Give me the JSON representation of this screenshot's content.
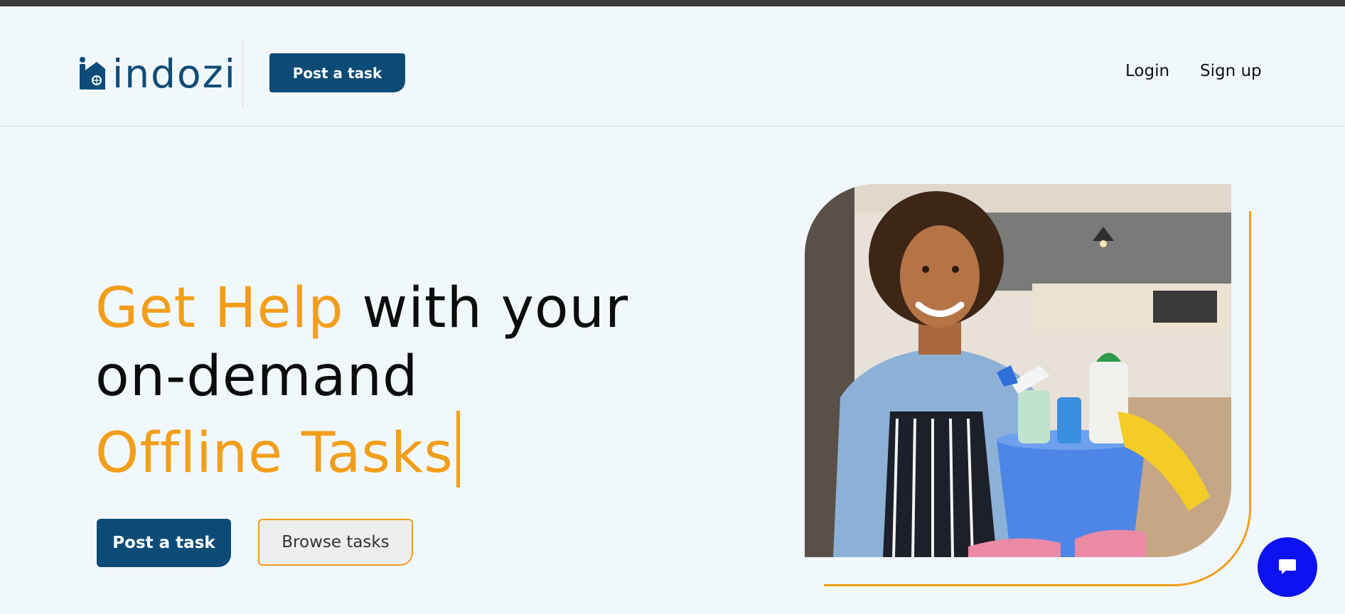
{
  "brand": {
    "name": "indozi",
    "color": "#0f4b78",
    "accent": "#f29e1a"
  },
  "header": {
    "post_task_label": "Post a task",
    "nav": {
      "login": "Login",
      "signup": "Sign up"
    }
  },
  "hero": {
    "title_part1": "Get Help",
    "title_part2": " with your",
    "title_line2": "on-demand",
    "title_line3": "Offline Tasks",
    "post_task_label": "Post a task",
    "browse_tasks_label": "Browse tasks"
  },
  "chat": {
    "icon": "chat-bubble-icon",
    "color": "#0d12f0"
  }
}
